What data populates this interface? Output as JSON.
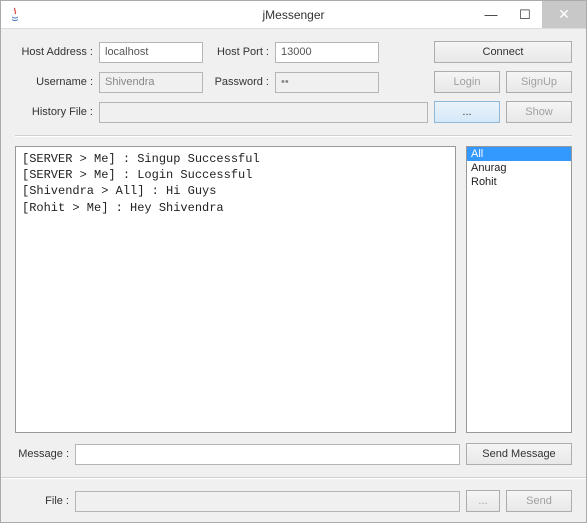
{
  "window": {
    "title": "jMessenger"
  },
  "connection": {
    "host_label": "Host Address :",
    "host_value": "localhost",
    "port_label": "Host Port :",
    "port_value": "13000",
    "connect_label": "Connect"
  },
  "auth": {
    "username_label": "Username :",
    "username_value": "Shivendra",
    "password_label": "Password :",
    "password_value": "••",
    "login_label": "Login",
    "signup_label": "SignUp"
  },
  "history": {
    "label": "History File :",
    "path_value": "",
    "browse_label": "...",
    "show_label": "Show"
  },
  "chat": {
    "lines": "[SERVER > Me] : Singup Successful\n[SERVER > Me] : Login Successful\n[Shivendra > All] : Hi Guys\n[Rohit > Me] : Hey Shivendra"
  },
  "users": {
    "items": [
      "All",
      "Anurag",
      "Rohit"
    ],
    "selected_index": 0
  },
  "message": {
    "label": "Message :",
    "value": "",
    "send_label": "Send Message"
  },
  "file": {
    "label": "File :",
    "value": "",
    "browse_label": "...",
    "send_label": "Send"
  }
}
